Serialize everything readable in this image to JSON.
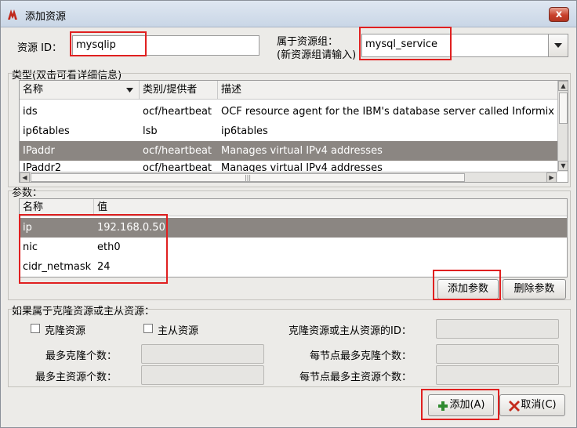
{
  "window": {
    "title": "添加资源",
    "close_label": "x"
  },
  "resource_id": {
    "label": "资源 ID：",
    "value": "mysqlip"
  },
  "resource_group": {
    "label_line1": "属于资源组：",
    "label_line2": "(新资源组请输入)",
    "value": "mysql_service",
    "dropdown_icon": "triangle-down-icon"
  },
  "type_section": {
    "label": "类型(双击可看详细信息)",
    "columns": [
      "名称",
      "类别/提供者",
      "描述"
    ],
    "rows": [
      {
        "name": "ids",
        "provider": "ocf/heartbeat",
        "desc": "OCF resource agent for the IBM's database server called Informix D"
      },
      {
        "name": "ip6tables",
        "provider": "lsb",
        "desc": "ip6tables"
      },
      {
        "name": "IPaddr",
        "provider": "ocf/heartbeat",
        "desc": "Manages virtual IPv4 addresses",
        "selected": true
      },
      {
        "name": "IPaddr2",
        "provider": "ocf/heartbeat",
        "desc": "Manages virtual IPv4 addresses"
      }
    ],
    "scrollbar_marker": "|||"
  },
  "params_section": {
    "label": "参数：",
    "columns": [
      "名称",
      "值"
    ],
    "rows": [
      {
        "name": "ip",
        "value": "192.168.0.50",
        "selected": true
      },
      {
        "name": "nic",
        "value": "eth0"
      },
      {
        "name": "cidr_netmask",
        "value": "24"
      }
    ],
    "add_button": "添加参数",
    "delete_button": "删除参数"
  },
  "clone_section": {
    "label": "如果属于克隆资源或主从资源：",
    "clone_checkbox": "克隆资源",
    "master_checkbox": "主从资源",
    "clone_or_master_id_label": "克隆资源或主从资源的ID：",
    "max_clones_label": "最多克隆个数：",
    "max_clones_per_node_label": "每节点最多克隆个数：",
    "max_masters_label": "最多主资源个数：",
    "max_masters_per_node_label": "每节点最多主资源个数："
  },
  "footer": {
    "add_button": "添加(A)",
    "cancel_button": "取消(C)"
  }
}
